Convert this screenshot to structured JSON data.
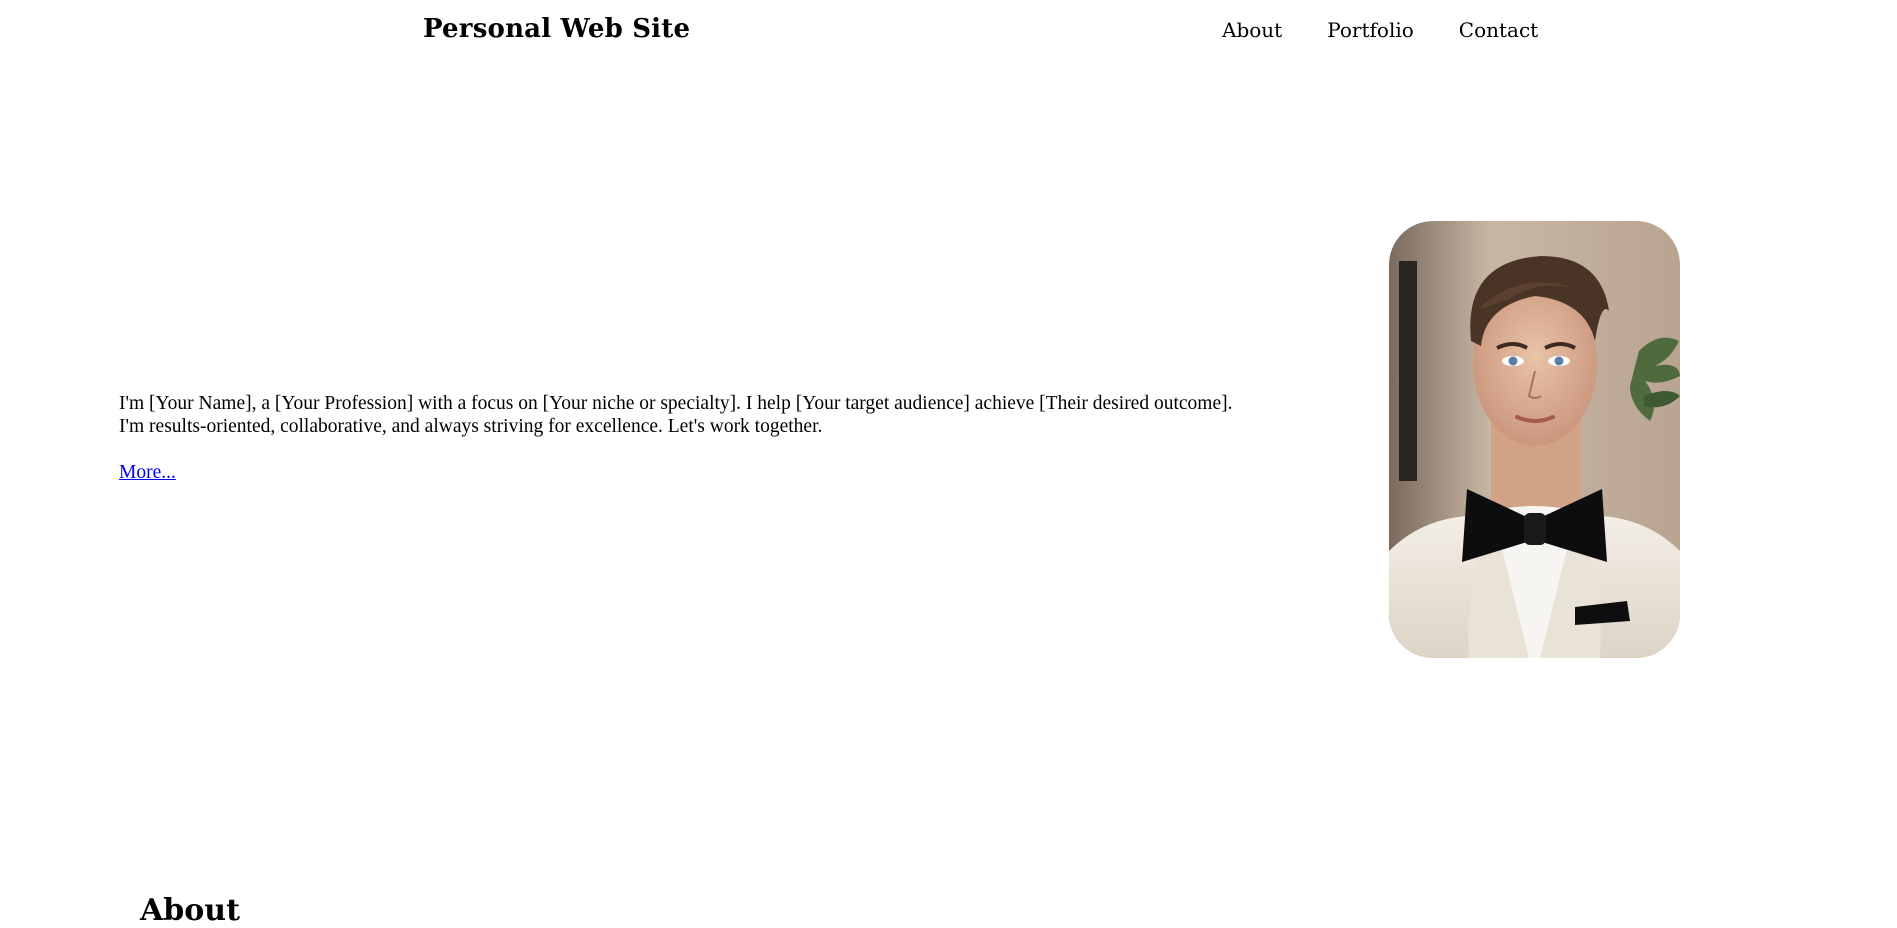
{
  "site": {
    "title": "Personal Web Site"
  },
  "nav": {
    "items": [
      {
        "label": "About"
      },
      {
        "label": "Portfolio"
      },
      {
        "label": "Contact"
      }
    ]
  },
  "hero": {
    "line1": "I'm [Your Name], a [Your Profession] with a focus on [Your niche or specialty]. I help [Your target audience] achieve [Their desired outcome].",
    "line2": "I'm results-oriented, collaborative, and always striving for excellence. Let's work together.",
    "more_link": "More...",
    "portrait_alt": "Portrait photo of a man in a white tuxedo jacket with a black bow tie"
  },
  "about": {
    "heading": "About"
  },
  "colors": {
    "link": "#0000ee",
    "text": "#000000",
    "background": "#ffffff"
  }
}
